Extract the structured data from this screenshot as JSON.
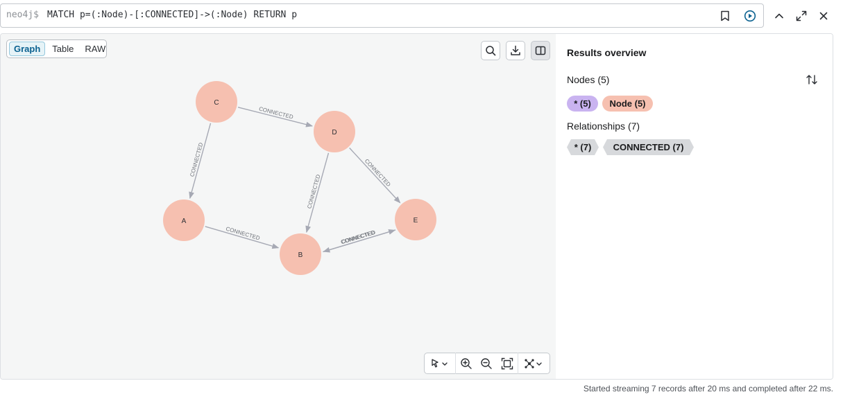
{
  "query": {
    "prompt": "neo4j$",
    "text": "MATCH p=(:Node)-[:CONNECTED]->(:Node) RETURN p",
    "icons": [
      "bookmark-icon",
      "run-icon"
    ]
  },
  "window_controls": {
    "icons": [
      "collapse-icon",
      "fullscreen-icon",
      "close-icon"
    ]
  },
  "view_tabs": [
    {
      "label": "Graph",
      "active": true
    },
    {
      "label": "Table",
      "active": false
    },
    {
      "label": "RAW",
      "active": false
    }
  ],
  "canvas_controls": {
    "icons": [
      "search-icon",
      "download-icon",
      "panel-icon"
    ]
  },
  "graph": {
    "node_color": "#f6c0b0",
    "edge_color": "#a6a9b4",
    "nodes": [
      {
        "id": "C",
        "label": "C"
      },
      {
        "id": "D",
        "label": "D"
      },
      {
        "id": "A",
        "label": "A"
      },
      {
        "id": "B",
        "label": "B"
      },
      {
        "id": "E",
        "label": "E"
      }
    ],
    "edges": [
      {
        "from": "C",
        "to": "D",
        "label": "CONNECTED"
      },
      {
        "from": "C",
        "to": "A",
        "label": "CONNECTED"
      },
      {
        "from": "D",
        "to": "B",
        "label": "CONNECTED"
      },
      {
        "from": "D",
        "to": "E",
        "label": "CONNECTED"
      },
      {
        "from": "A",
        "to": "B",
        "label": "CONNECTED"
      },
      {
        "from": "B",
        "to": "E",
        "label": "CONNECTED"
      },
      {
        "from": "E",
        "to": "B",
        "label": "CONNECTED"
      }
    ]
  },
  "bottom_tools": {
    "icons": [
      "pointer-icon",
      "zoom-in-icon",
      "zoom-out-icon",
      "fit-icon",
      "layout-icon"
    ]
  },
  "overview": {
    "title": "Results overview",
    "nodes_label": "Nodes (5)",
    "node_pills": [
      {
        "label": "* (5)",
        "color": "#c9b3f0"
      },
      {
        "label": "Node (5)",
        "color": "#f6c0b0"
      }
    ],
    "relationships_label": "Relationships (7)",
    "rel_pills": [
      {
        "label": "* (7)"
      },
      {
        "label": "CONNECTED (7)"
      }
    ]
  },
  "status": "Started streaming 7 records after 20 ms and completed after 22 ms."
}
